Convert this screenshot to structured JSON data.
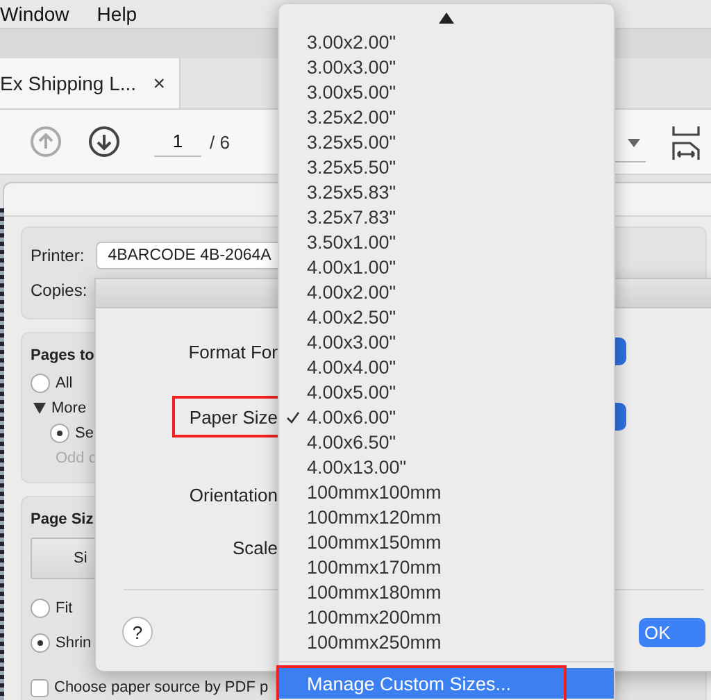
{
  "menu_bar": {
    "items": [
      "Window",
      "Help"
    ]
  },
  "tab": {
    "title": "Ex Shipping L...",
    "close": "×"
  },
  "toolbar": {
    "page": "1",
    "total": "/ 6"
  },
  "print_dialog": {
    "printer": {
      "label": "Printer:",
      "value": "4BARCODE 4B-2064A"
    },
    "copies": {
      "label": "Copies:"
    },
    "pages": {
      "heading": "Pages to",
      "all": {
        "label": "All",
        "selected": false
      },
      "more": {
        "label": "More",
        "expanded": true
      },
      "subset": {
        "label": "Se",
        "selected": true
      },
      "odd": {
        "label": "Odd c",
        "disabled": true
      }
    },
    "page_size": {
      "heading": "Page Siz",
      "button": "Si",
      "options": [
        {
          "label": "Fit",
          "selected": false
        },
        {
          "label": "Shrin",
          "selected": true
        }
      ],
      "paper_source": {
        "label": "Choose paper source by PDF p",
        "checked": false
      }
    }
  },
  "page_setup": {
    "rows": [
      {
        "label": "Format For",
        "annotated": false
      },
      {
        "label": "Paper Size",
        "annotated": true
      },
      {
        "label": "Orientation",
        "annotated": false
      },
      {
        "label": "Scale",
        "annotated": false
      }
    ],
    "help": "?",
    "ok": "OK"
  },
  "paper_menu": {
    "items": [
      {
        "label": "3.00x2.00\"",
        "checked": false
      },
      {
        "label": "3.00x3.00\"",
        "checked": false
      },
      {
        "label": "3.00x5.00\"",
        "checked": false
      },
      {
        "label": "3.25x2.00\"",
        "checked": false
      },
      {
        "label": "3.25x5.00\"",
        "checked": false
      },
      {
        "label": "3.25x5.50\"",
        "checked": false
      },
      {
        "label": "3.25x5.83\"",
        "checked": false
      },
      {
        "label": "3.25x7.83\"",
        "checked": false
      },
      {
        "label": "3.50x1.00\"",
        "checked": false
      },
      {
        "label": "4.00x1.00\"",
        "checked": false
      },
      {
        "label": "4.00x2.00\"",
        "checked": false
      },
      {
        "label": "4.00x2.50\"",
        "checked": false
      },
      {
        "label": "4.00x3.00\"",
        "checked": false
      },
      {
        "label": "4.00x4.00\"",
        "checked": false
      },
      {
        "label": "4.00x5.00\"",
        "checked": false
      },
      {
        "label": "4.00x6.00\"",
        "checked": true
      },
      {
        "label": "4.00x6.50\"",
        "checked": false
      },
      {
        "label": "4.00x13.00\"",
        "checked": false
      },
      {
        "label": "100mmx100mm",
        "checked": false
      },
      {
        "label": "100mmx120mm",
        "checked": false
      },
      {
        "label": "100mmx150mm",
        "checked": false
      },
      {
        "label": "100mmx170mm",
        "checked": false
      },
      {
        "label": "100mmx180mm",
        "checked": false
      },
      {
        "label": "100mmx200mm",
        "checked": false
      },
      {
        "label": "100mmx250mm",
        "checked": false
      }
    ],
    "footer": {
      "label": "Manage Custom Sizes...",
      "highlighted": true,
      "annotated": true
    }
  }
}
